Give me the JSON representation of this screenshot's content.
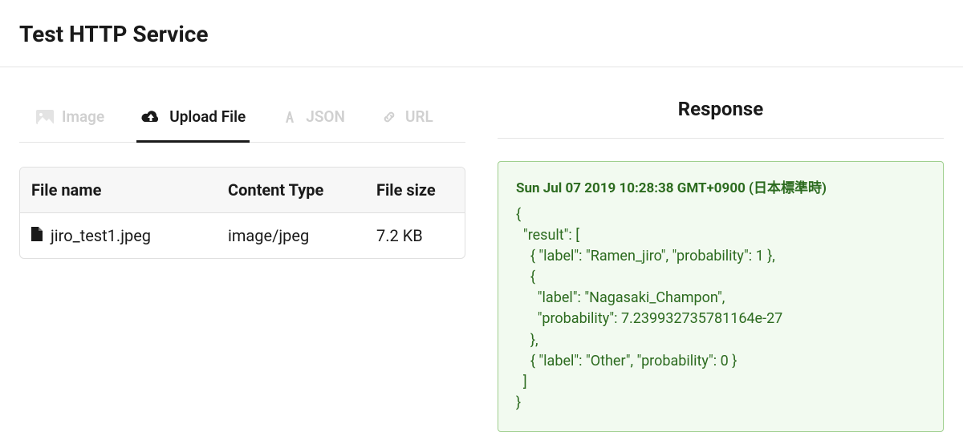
{
  "page_title": "Test HTTP Service",
  "tabs": {
    "image": "Image",
    "upload": "Upload File",
    "json": "JSON",
    "url": "URL"
  },
  "files": {
    "headers": {
      "name": "File name",
      "type": "Content Type",
      "size": "File size"
    },
    "rows": [
      {
        "name": "jiro_test1.jpeg",
        "type": "image/jpeg",
        "size": "7.2 KB"
      }
    ]
  },
  "response": {
    "heading": "Response",
    "timestamp": "Sun Jul 07 2019 10:28:38 GMT+0900 (日本標準時)",
    "body": "{\n  \"result\": [\n    { \"label\": \"Ramen_jiro\", \"probability\": 1 },\n    {\n      \"label\": \"Nagasaki_Champon\",\n      \"probability\": 7.239932735781164e-27\n    },\n    { \"label\": \"Other\", \"probability\": 0 }\n  ]\n}"
  }
}
